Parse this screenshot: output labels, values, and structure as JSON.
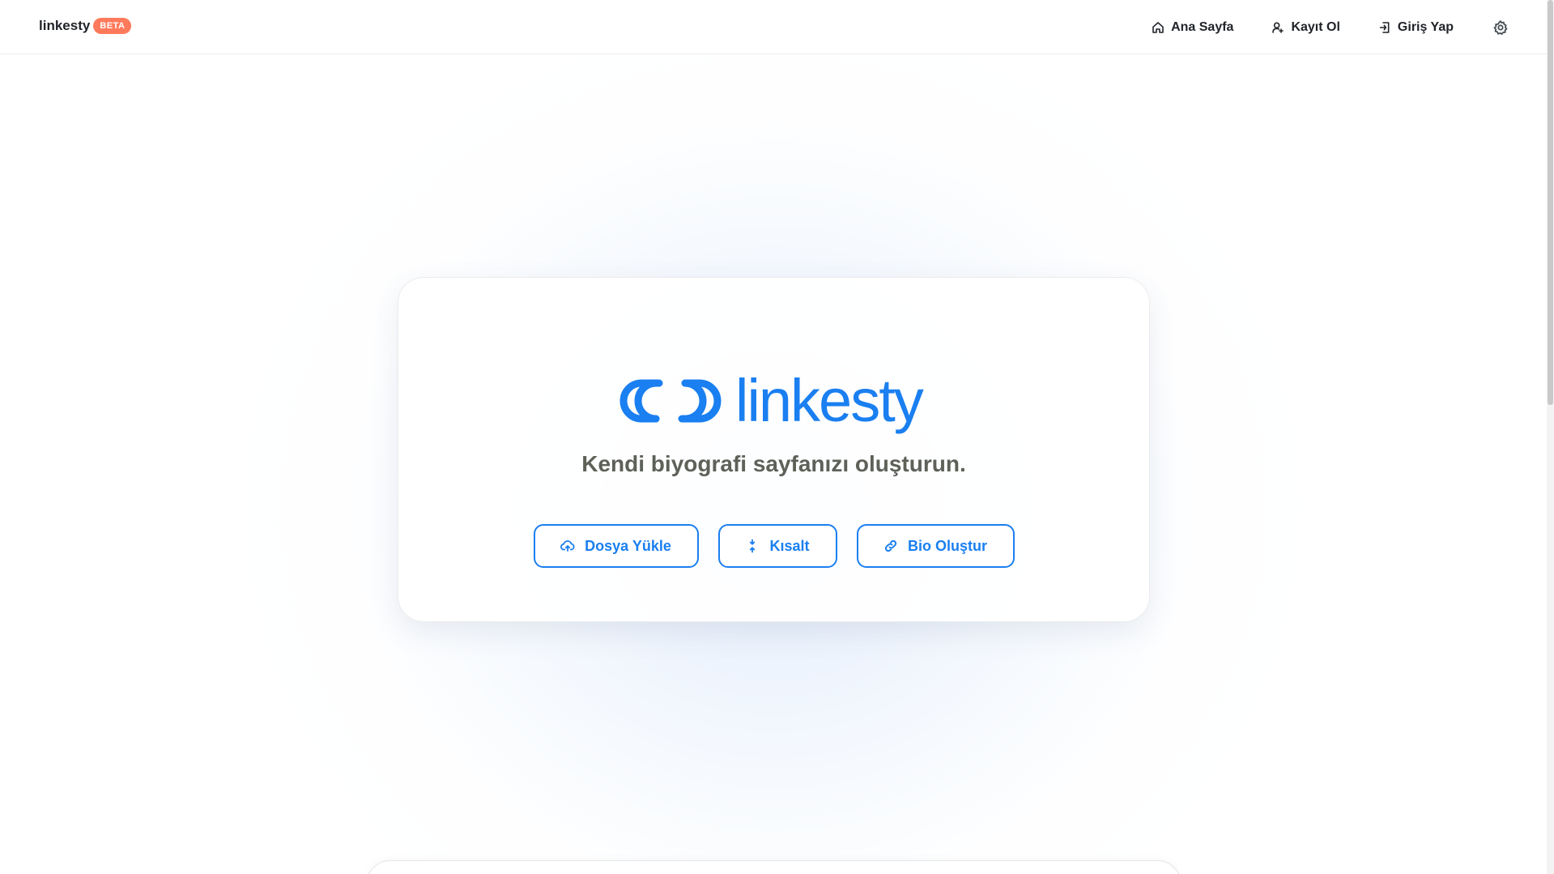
{
  "header": {
    "brand": "linkesty",
    "badge": "BETA",
    "nav": [
      {
        "label": "Ana Sayfa",
        "icon": "home-icon"
      },
      {
        "label": "Kayıt Ol",
        "icon": "user-add-icon"
      },
      {
        "label": "Giriş Yap",
        "icon": "login-icon"
      }
    ],
    "settings_icon": "gear-icon"
  },
  "hero": {
    "logo_text": "linkesty",
    "logo_icon": "chain-link-icon",
    "tagline": "Kendi biyografi sayfanızı oluşturun.",
    "buttons": [
      {
        "label": "Dosya Yükle",
        "icon": "cloud-upload-icon"
      },
      {
        "label": "Kısalt",
        "icon": "shorten-arrows-icon"
      },
      {
        "label": "Bio Oluştur",
        "icon": "link-icon"
      }
    ]
  },
  "colors": {
    "accent": "#1a7ff0",
    "badge": "#ff7a5c",
    "tagline": "#5d6158",
    "text": "#1f2328"
  }
}
